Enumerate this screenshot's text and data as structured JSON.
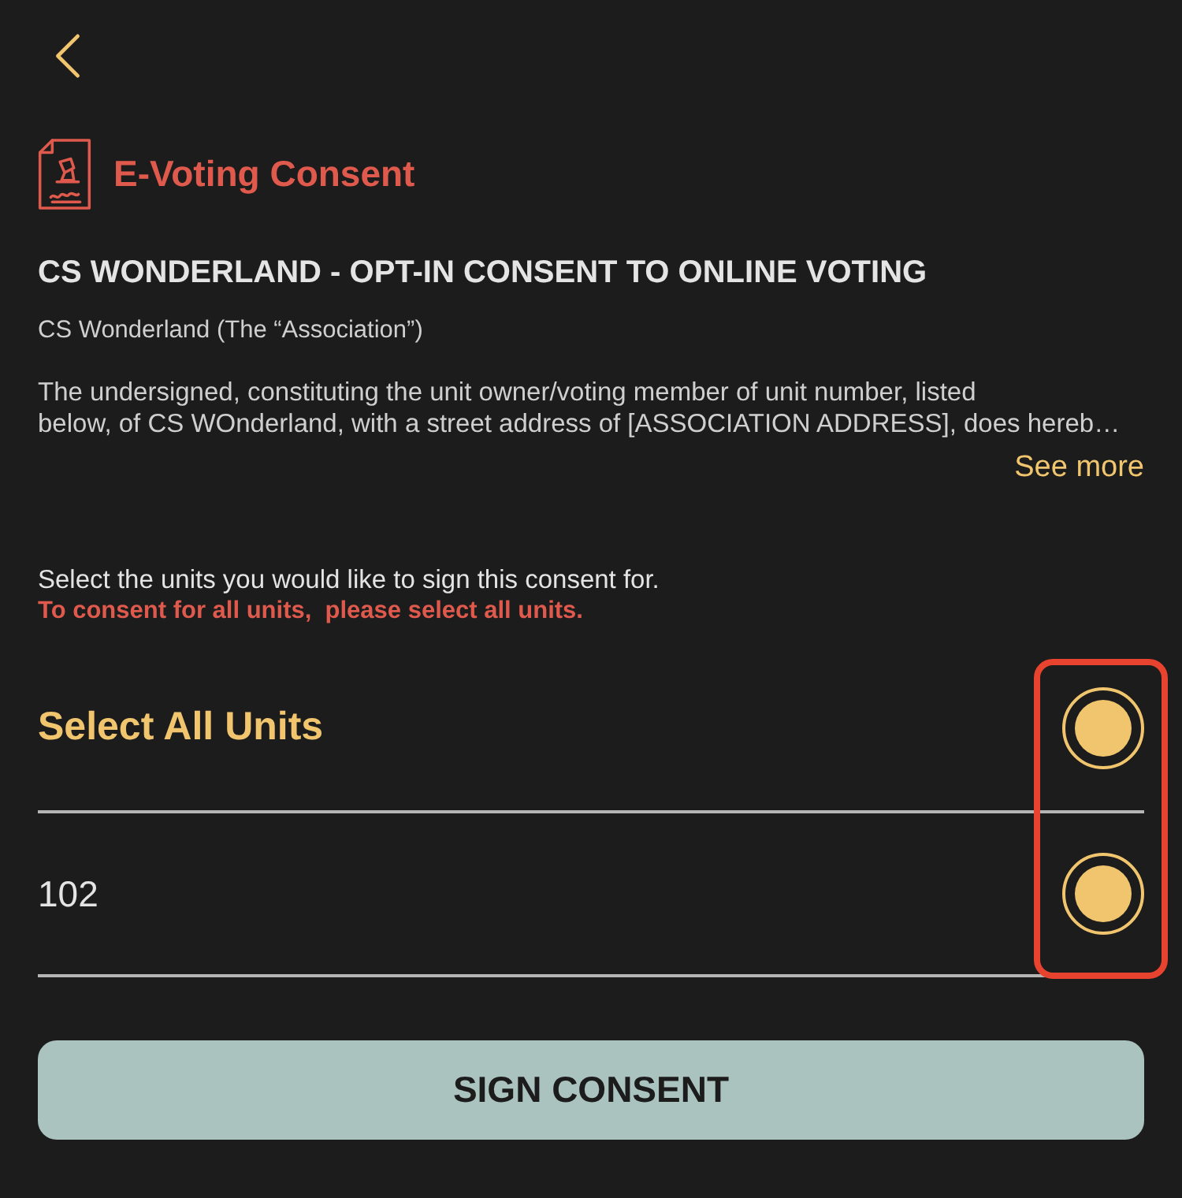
{
  "page": {
    "title": "E-Voting Consent"
  },
  "document": {
    "heading": "CS WONDERLAND - OPT-IN CONSENT TO ONLINE VOTING",
    "subtitle": "CS Wonderland (The “Association”)",
    "body": "The undersigned, constituting the unit owner/voting member of unit number, listed\nbelow, of CS WOnderland, with a street address of [ASSOCIATION ADDRESS], does hereb…",
    "see_more": "See more"
  },
  "unit_selection": {
    "instruction": "Select the units you would like to sign this consent for.",
    "warning": "To consent for all units,  please select all units.",
    "select_all": {
      "label": "Select All Units",
      "selected": true
    },
    "units": [
      {
        "label": "102",
        "selected": true
      }
    ],
    "highlighted": true
  },
  "sign_button": {
    "label": "SIGN CONSENT"
  }
}
